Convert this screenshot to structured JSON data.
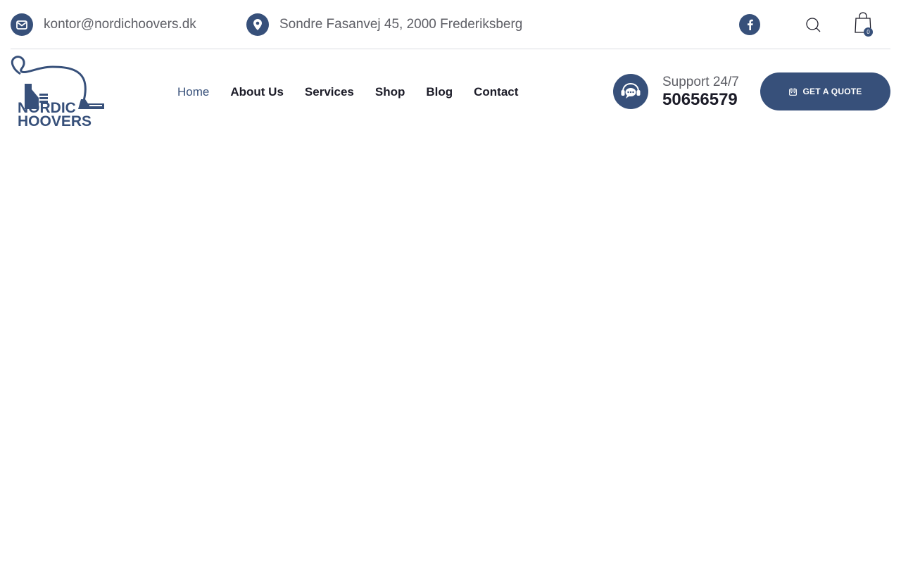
{
  "topbar": {
    "email": "kontor@nordichoovers.dk",
    "address": "Sondre Fasanvej 45, 2000 Frederiksberg",
    "cart_count": "0"
  },
  "icons": {
    "email": "envelope-icon",
    "address": "map-pin-icon",
    "social": "facebook-icon",
    "search": "search-icon",
    "cart": "shopping-bag-icon",
    "support": "headset-chat-icon",
    "quote": "calendar-icon"
  },
  "logo": {
    "line1": "NORDIC",
    "line2": "HOOVERS"
  },
  "nav": {
    "items": [
      {
        "label": "Home"
      },
      {
        "label": "About Us"
      },
      {
        "label": "Services"
      },
      {
        "label": "Shop"
      },
      {
        "label": "Blog"
      },
      {
        "label": "Contact"
      }
    ]
  },
  "support": {
    "label": "Support 24/7",
    "phone": "50656579"
  },
  "cta": {
    "label": "GET A QUOTE"
  },
  "colors": {
    "brand": "#37507a",
    "text": "#1c1c28",
    "muted": "#5e5f66"
  }
}
